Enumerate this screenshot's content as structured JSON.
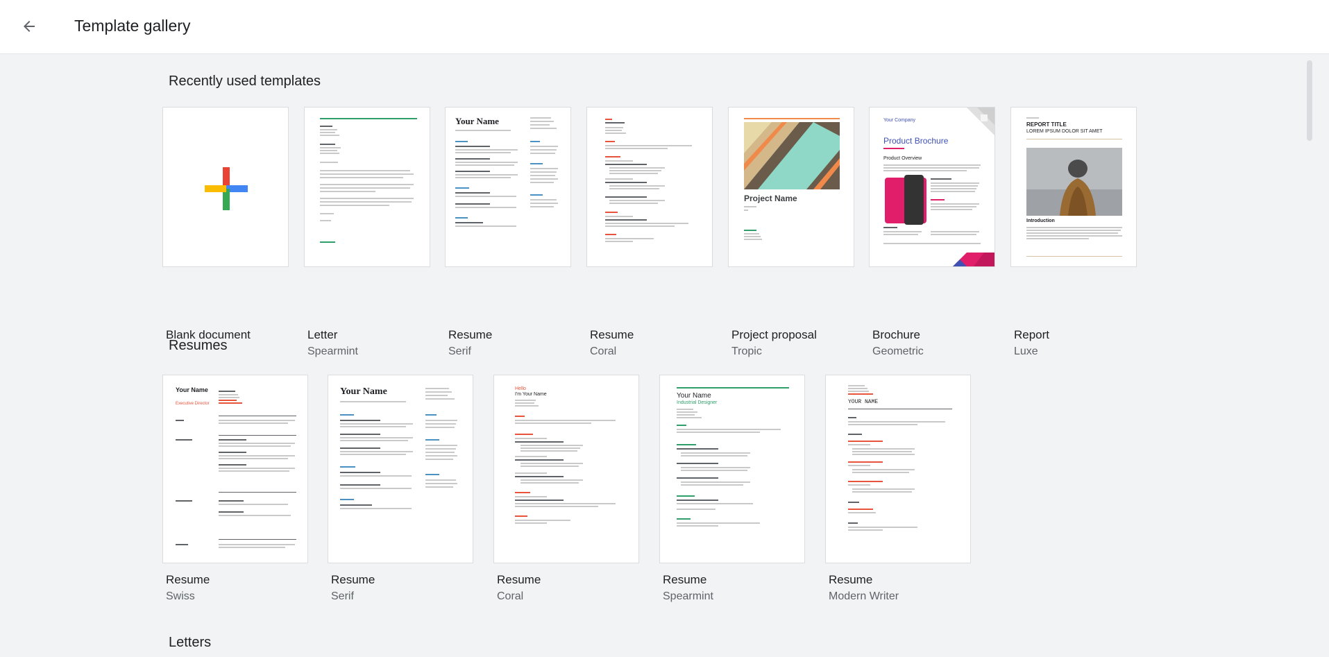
{
  "header": {
    "title": "Template gallery",
    "back_icon": "arrow-left-icon"
  },
  "sections": {
    "recent": {
      "title": "Recently used templates",
      "cards": [
        {
          "name": "Blank document",
          "sub": ""
        },
        {
          "name": "Letter",
          "sub": "Spearmint"
        },
        {
          "name": "Resume",
          "sub": "Serif"
        },
        {
          "name": "Resume",
          "sub": "Coral"
        },
        {
          "name": "Project proposal",
          "sub": "Tropic"
        },
        {
          "name": "Brochure",
          "sub": "Geometric"
        },
        {
          "name": "Report",
          "sub": "Luxe"
        }
      ]
    },
    "resumes": {
      "title": "Resumes",
      "cards": [
        {
          "name": "Resume",
          "sub": "Swiss"
        },
        {
          "name": "Resume",
          "sub": "Serif"
        },
        {
          "name": "Resume",
          "sub": "Coral"
        },
        {
          "name": "Resume",
          "sub": "Spearmint"
        },
        {
          "name": "Resume",
          "sub": "Modern Writer"
        }
      ]
    },
    "letters": {
      "title": "Letters"
    }
  },
  "thumb_text": {
    "your_name": "Your Name",
    "your_name_upper": "YOUR NAME",
    "project_name": "Project Name",
    "product_brochure": "Product Brochure",
    "product_overview": "Product Overview",
    "your_company": "Your Company",
    "report_title": "REPORT TITLE",
    "report_sub": "LOREM IPSUM DOLOR SIT AMET",
    "introduction": "Introduction",
    "hello": "Hello",
    "im_name": "I'm Your Name",
    "executive_director": "Executive Director",
    "industrial_designer": "Industrial Designer"
  },
  "colors": {
    "plus_red": "#ea4335",
    "plus_blue": "#4285f4",
    "plus_yellow": "#fbbc04",
    "plus_green": "#34a853",
    "spearmint": "#2e9e6a",
    "coral": "#e8533b",
    "tropic_teal": "#8fd8c7",
    "tropic_orange": "#f08a4b",
    "brochure_pink": "#e01e6a",
    "brochure_blue": "#3f51b5"
  }
}
